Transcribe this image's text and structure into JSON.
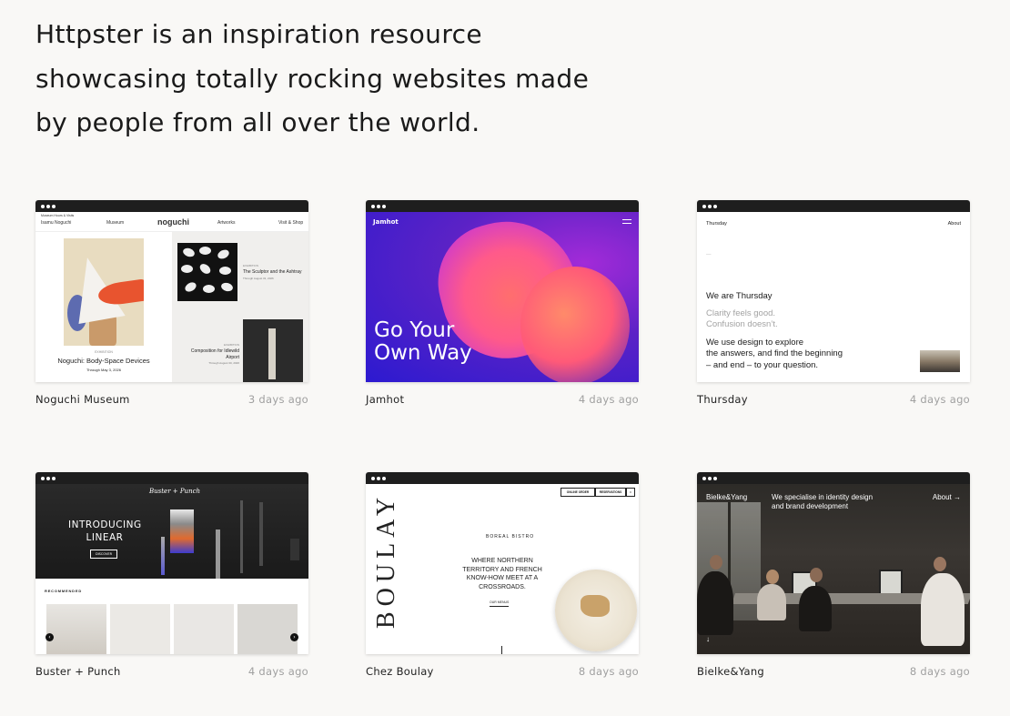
{
  "intro": {
    "line1": "Httpster is an inspiration resource",
    "line2": "showcasing totally rocking websites made",
    "line3": "by people from all over the world."
  },
  "cards": [
    {
      "name": "Noguchi Museum",
      "date": "3 days ago",
      "preview": {
        "nav_left_top": "Museum Hours & Visits",
        "nav_left": "Isamu Noguchi",
        "nav_museum": "Museum",
        "logo": "noguchi",
        "nav_artworks": "Artworks",
        "nav_visit": "Visit & Shop",
        "main_kicker": "EXHIBITION",
        "main_title": "Noguchi: Body-Space Devices",
        "main_date": "Through May 3, 2026",
        "side1_kicker": "EXHIBITION",
        "side1_title": "The Sculptor and the Ashtray",
        "side1_date": "Through August 31, 2026",
        "side2_kicker": "EXHIBITION",
        "side2_title": "Composition for Idlewild Airport",
        "side2_date": "Through August 30, 2026"
      }
    },
    {
      "name": "Jamhot",
      "date": "4 days ago",
      "preview": {
        "logo": "Jamhot",
        "headline_1": "Go Your",
        "headline_2": "Own Way"
      }
    },
    {
      "name": "Thursday",
      "date": "4 days ago",
      "preview": {
        "logo": "Thursday",
        "nav_about": "About",
        "dash": "—",
        "line1": "We are Thursday",
        "line2": "Clarity feels good.",
        "line3": "Confusion doesn’t.",
        "line4": "We use design to explore",
        "line5": "the answers, and find the beginning",
        "line6": "– and end – to your question."
      }
    },
    {
      "name": "Buster + Punch",
      "date": "4 days ago",
      "preview": {
        "brand": "Buster + Punch",
        "intro_1": "INTRODUCING",
        "intro_2": "LINEAR",
        "cta": "DISCOVER",
        "recommended": "RECOMMENDED"
      }
    },
    {
      "name": "Chez Boulay",
      "date": "8 days ago",
      "preview": {
        "vertical": "BOULAY",
        "btn_order": "ONLINE ORDER",
        "btn_reserve": "RESERVATIONS",
        "kicker": "BOREAL BISTRO",
        "line1": "WHERE NORTHERN",
        "line2": "TERRITORY AND FRENCH",
        "line3": "KNOW-HOW MEET AT A",
        "line4": "CROSSROADS.",
        "menu": "OUR MENUS"
      }
    },
    {
      "name": "Bielke&Yang",
      "date": "8 days ago",
      "preview": {
        "logo": "Bielke&Yang",
        "tag_1": "We specialise in identity design",
        "tag_2": "and brand development",
        "about": "About →",
        "arrow": "↓"
      }
    }
  ],
  "colors": {
    "background": "#f9f8f6",
    "chrome": "#1e1e1e",
    "date_text": "#a0a0a0"
  }
}
